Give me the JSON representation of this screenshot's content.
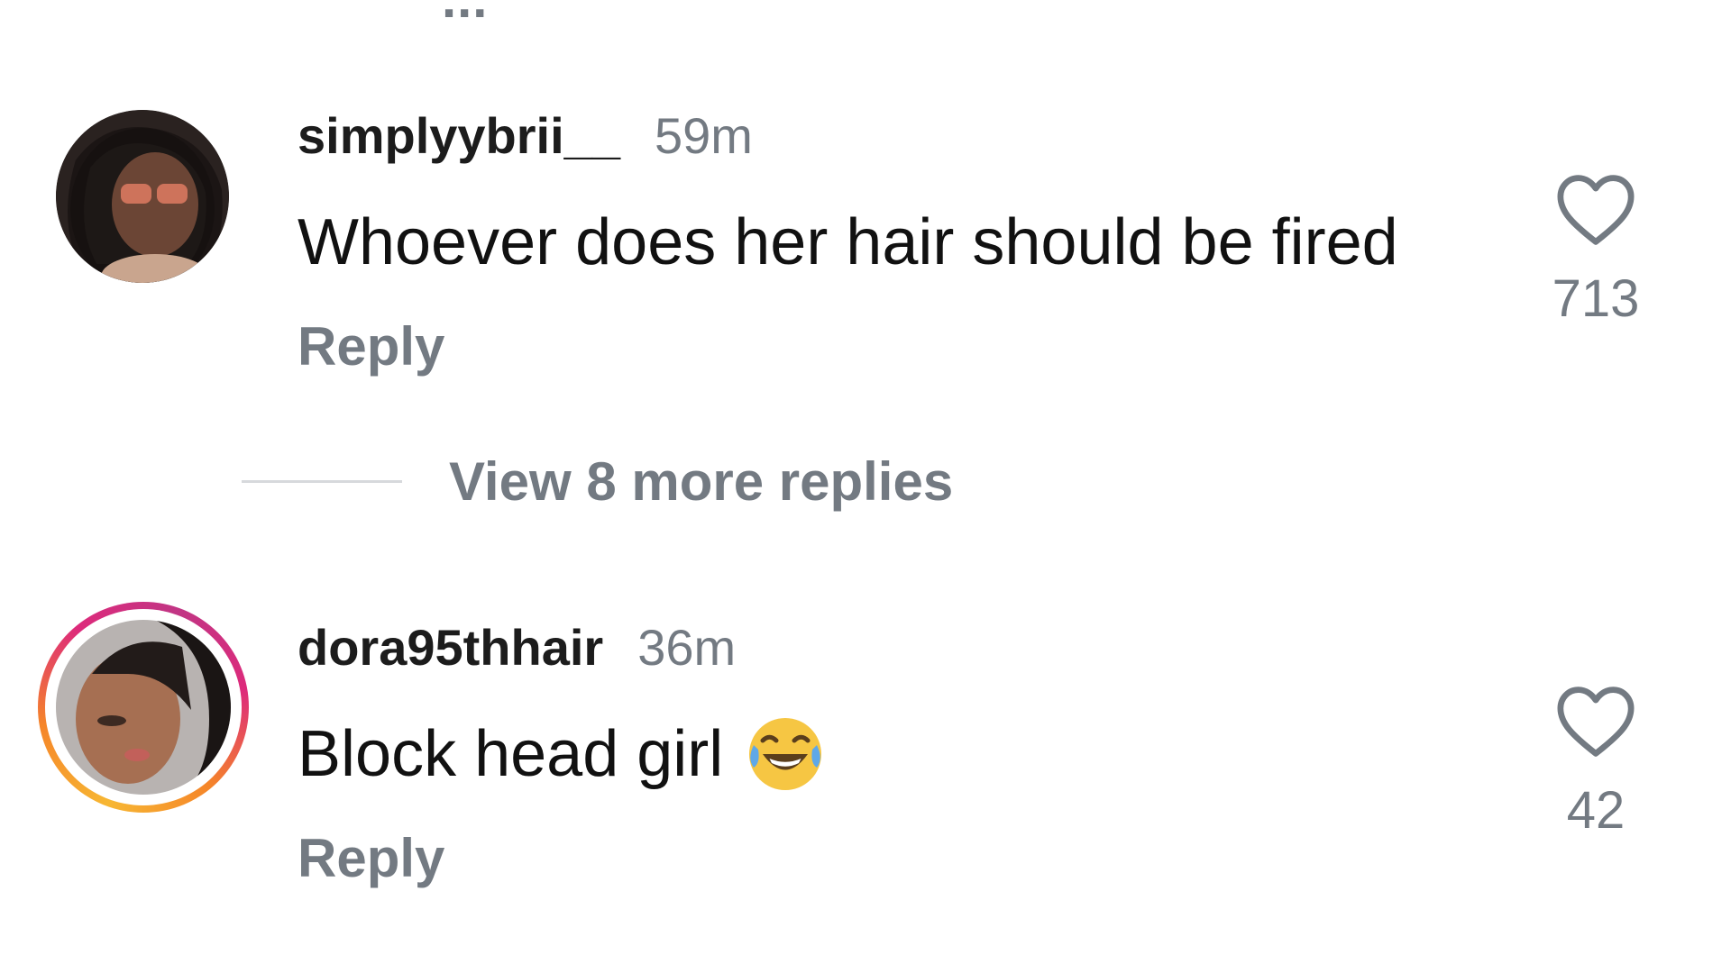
{
  "top_fragment": "...",
  "comments": [
    {
      "username": "simplyybrii__",
      "time": "59m",
      "text": "Whoever does her hair should be fired",
      "emoji": "",
      "reply_label": "Reply",
      "likes": "713",
      "avatar_has_story_ring": false
    },
    {
      "username": "dora95thhair",
      "time": "36m",
      "text": "Block head girl",
      "emoji": "face-with-tears-of-joy",
      "reply_label": "Reply",
      "likes": "42",
      "avatar_has_story_ring": true
    }
  ],
  "view_replies": [
    {
      "label": "View 8 more replies"
    }
  ],
  "colors": {
    "text_primary": "#111111",
    "text_secondary": "#737a82",
    "divider": "#d7d9dc",
    "story_ring_start": "#f7b733",
    "story_ring_end": "#dd2a7b"
  }
}
